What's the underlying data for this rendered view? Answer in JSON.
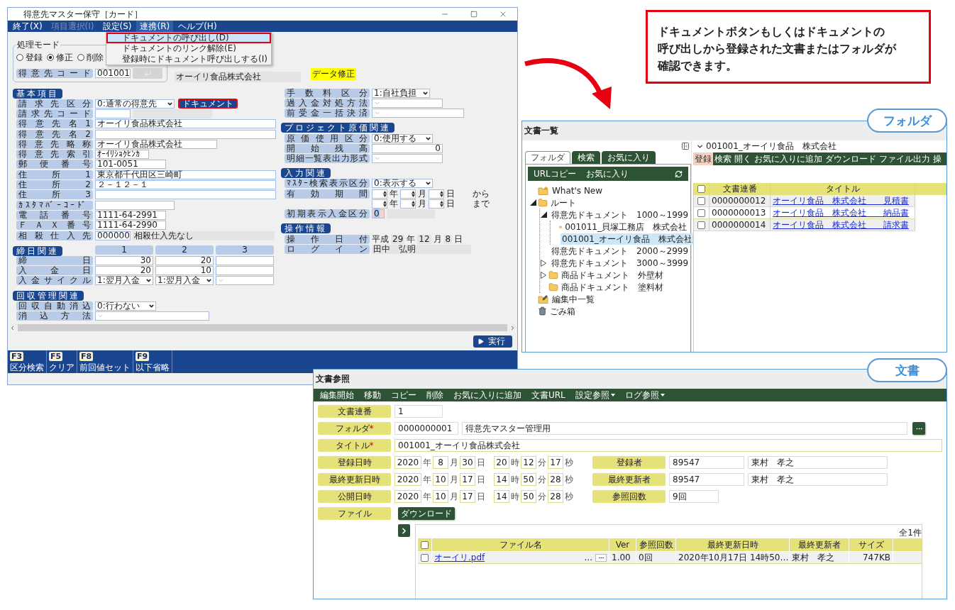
{
  "form_window": {
    "title": "得意先マスター保守［カード］",
    "menu": [
      {
        "label": "終了(X)",
        "disabled": false,
        "selected": false
      },
      {
        "label": "項目選択(I)",
        "disabled": true,
        "selected": false
      },
      {
        "label": "設定(S)",
        "disabled": false,
        "selected": false
      },
      {
        "label": "連携(R)",
        "disabled": false,
        "selected": true
      },
      {
        "label": "ヘルプ(H)",
        "disabled": false,
        "selected": false
      }
    ],
    "menu_dropdown": [
      {
        "label": "ドキュメントの呼び出し(D)",
        "selected": true,
        "annotated": true
      },
      {
        "label": "ドキュメントのリンク解除(E)",
        "selected": false,
        "annotated": false
      },
      {
        "label": "登録時にドキュメント呼び出しする(I)",
        "selected": false,
        "annotated": false
      }
    ],
    "mode": {
      "legend": "処理モード",
      "options": [
        {
          "label": "登録",
          "selected": false
        },
        {
          "label": "修正",
          "selected": true
        },
        {
          "label": "削除",
          "selected": false
        }
      ]
    },
    "code_row": {
      "label": "得意先コード",
      "value": "001001",
      "button_disabled": true,
      "name": "オーイリ食品株式会社"
    },
    "status_badge": "データ修正",
    "left_sections": [
      {
        "title": "基本項目",
        "rows": [
          {
            "label": "請求先区分",
            "fields": [
              {
                "kind": "select",
                "value": "0:通常の得意先"
              },
              {
                "kind": "button",
                "label": "ドキュメント",
                "annotated": true
              }
            ]
          },
          {
            "label": "請求先コード",
            "fields": [
              {
                "kind": "input"
              },
              {
                "kind": "readonly"
              }
            ]
          },
          {
            "label": "得意先名1",
            "fields": [
              {
                "kind": "input",
                "value": "オーイリ食品株式会社"
              }
            ]
          },
          {
            "label": "得意先名2",
            "fields": [
              {
                "kind": "input"
              }
            ]
          },
          {
            "label": "得意先略称",
            "fields": [
              {
                "kind": "input",
                "value": "オーイリ食品株式会社"
              }
            ]
          },
          {
            "label": "得意先索引",
            "fields": [
              {
                "kind": "input",
                "value": "ｵｰｲﾘｼｮｸﾋﾝｶ"
              }
            ]
          },
          {
            "label": "郵便番号",
            "fields": [
              {
                "kind": "input",
                "value": "101-0051"
              }
            ]
          },
          {
            "label": "住所1",
            "fields": [
              {
                "kind": "input",
                "value": "東京都千代田区三崎町"
              }
            ]
          },
          {
            "label": "住所2",
            "fields": [
              {
                "kind": "input",
                "value": "２－１２－１"
              }
            ]
          },
          {
            "label": "住所3",
            "fields": [
              {
                "kind": "input"
              }
            ]
          },
          {
            "label": "ｶｽﾀﾏﾊﾞｰｺｰﾄﾞ",
            "fields": [
              {
                "kind": "input"
              }
            ]
          },
          {
            "label": "電話番号",
            "fields": [
              {
                "kind": "input",
                "value": "1111-64-2991"
              }
            ]
          },
          {
            "label": "ＦＡＸ番号",
            "fields": [
              {
                "kind": "input",
                "value": "1111-64-2990"
              }
            ]
          },
          {
            "label": "相殺仕入先",
            "fields": [
              {
                "kind": "input",
                "value": "000000"
              },
              {
                "kind": "readonly",
                "value": "相殺仕入先なし"
              }
            ]
          }
        ]
      },
      {
        "title": "締日関連",
        "columns": [
          "1",
          "2",
          "3"
        ],
        "rows": [
          {
            "label": "締日",
            "fields": [
              {
                "kind": "number",
                "value": "30"
              },
              {
                "kind": "number",
                "value": "20"
              },
              {
                "kind": "number"
              }
            ]
          },
          {
            "label": "入金日",
            "fields": [
              {
                "kind": "number",
                "value": "20"
              },
              {
                "kind": "number",
                "value": "10"
              },
              {
                "kind": "number"
              }
            ]
          },
          {
            "label": "入金サイクル",
            "fields": [
              {
                "kind": "select",
                "value": "1:翌月入金"
              },
              {
                "kind": "select",
                "value": "1:翌月入金"
              },
              {
                "kind": "select"
              }
            ]
          }
        ]
      },
      {
        "title": "回収管理関連",
        "rows": [
          {
            "label": "回収自動消込",
            "fields": [
              {
                "kind": "select",
                "value": "0:行わない"
              }
            ]
          },
          {
            "label": "消込方法",
            "fields": [
              {
                "kind": "select"
              }
            ]
          }
        ]
      }
    ],
    "right_sections": [
      {
        "rows": [
          {
            "label": "手数料区分",
            "fields": [
              {
                "kind": "select",
                "value": "1:自社負担"
              }
            ]
          },
          {
            "label": "過入金対処方法",
            "fields": [
              {
                "kind": "select"
              }
            ]
          },
          {
            "label": "前受金一括決済",
            "fields": [
              {
                "kind": "select"
              }
            ]
          }
        ]
      },
      {
        "title": "プロジェクト原価関連",
        "rows": [
          {
            "label": "原価使用区分",
            "fields": [
              {
                "kind": "select",
                "value": "0:使用する"
              }
            ]
          },
          {
            "label": "開始残高",
            "fields": [
              {
                "kind": "number",
                "value": "0"
              }
            ]
          },
          {
            "label": "明細一覧表出力形式",
            "fields": [
              {
                "kind": "select"
              }
            ]
          }
        ]
      },
      {
        "title": "入力関連",
        "rows": [
          {
            "label": "ﾏｽﾀｰ検索表示区分",
            "fields": [
              {
                "kind": "select",
                "value": "0:表示する"
              }
            ]
          },
          {
            "label": "有効期間",
            "fields": [
              {
                "kind": "spin"
              },
              {
                "kind": "unit",
                "text": "年"
              },
              {
                "kind": "spin"
              },
              {
                "kind": "unit",
                "text": "月"
              },
              {
                "kind": "spin"
              },
              {
                "kind": "unit",
                "text": "日"
              },
              {
                "kind": "text",
                "text": "から"
              }
            ]
          },
          {
            "fields": [
              {
                "kind": "spin"
              },
              {
                "kind": "unit",
                "text": "年"
              },
              {
                "kind": "spin"
              },
              {
                "kind": "unit",
                "text": "月"
              },
              {
                "kind": "spin"
              },
              {
                "kind": "unit",
                "text": "日"
              },
              {
                "kind": "text",
                "text": "まで"
              }
            ]
          },
          {
            "label": "初期表示入金区分",
            "fields": [
              {
                "kind": "input",
                "value": "0",
                "focused": true
              },
              {
                "kind": "readonly"
              }
            ]
          }
        ]
      },
      {
        "title": "操作情報",
        "rows": [
          {
            "label": "操作日付",
            "fields": [
              {
                "kind": "unit",
                "text": "平成"
              },
              {
                "kind": "cell",
                "value": "29"
              },
              {
                "kind": "unit",
                "text": "年"
              },
              {
                "kind": "cell",
                "value": "12"
              },
              {
                "kind": "unit",
                "text": "月"
              },
              {
                "kind": "cell",
                "value": "8"
              },
              {
                "kind": "unit",
                "text": "日"
              }
            ]
          },
          {
            "label": "ログイン",
            "fields": [
              {
                "kind": "readonly",
                "value": "田中　弘明"
              }
            ]
          }
        ]
      }
    ],
    "execute_button": "実行",
    "function_keys": [
      {
        "key": "F3",
        "label": "区分検索"
      },
      {
        "key": "F5",
        "label": "クリア"
      },
      {
        "key": "F8",
        "label": "前回値セット"
      },
      {
        "key": "F9",
        "label": "以下省略"
      }
    ]
  },
  "callout": {
    "lines": [
      "ドキュメントボタンもしくはドキュメントの",
      "呼び出しから登録された文書またはフォルダが",
      "確認できます。"
    ]
  },
  "folder_window": {
    "title": "文書一覧",
    "badge": "フォルダ",
    "tabs": [
      {
        "label": "フォルダ",
        "selected": true
      },
      {
        "label": "検索",
        "selected": false
      },
      {
        "label": "お気に入り",
        "selected": false
      }
    ],
    "tree_toolbar": [
      "URLコピー",
      "お気に入り"
    ],
    "tree": [
      {
        "label": "What's New",
        "kind": "new",
        "selected": false
      },
      {
        "label": "ルート",
        "kind": "folder",
        "selected": false,
        "expanded": true,
        "children": [
          {
            "label": "得意先ドキュメント　1000～1999",
            "kind": "folder",
            "selected": false,
            "expanded": true,
            "children": [
              {
                "label": "001011_貝塚工務店　株式会社",
                "kind": "folder",
                "selected": false
              },
              {
                "label": "001001_オーイリ食品　株式会社",
                "kind": "folder",
                "selected": true
              }
            ]
          },
          {
            "label": "得意先ドキュメント　2000～2999",
            "kind": "folder",
            "selected": false
          },
          {
            "label": "得意先ドキュメント　3000～3999",
            "kind": "folder",
            "selected": false,
            "expanded": false
          },
          {
            "label": "商品ドキュメント　外壁材",
            "kind": "folder",
            "selected": false,
            "expanded": false
          },
          {
            "label": "商品ドキュメント　塗料材",
            "kind": "folder",
            "selected": false
          }
        ]
      },
      {
        "label": "編集中一覧",
        "kind": "edit",
        "selected": false
      },
      {
        "label": "ごみ箱",
        "kind": "trash",
        "selected": false
      }
    ],
    "path": "001001_オーイリ食品　株式会社",
    "actions": [
      {
        "label": "登録",
        "selected": true
      },
      {
        "label": "検索",
        "selected": false
      },
      {
        "label": "開く",
        "selected": false
      },
      {
        "label": "お気に入りに追加",
        "selected": false
      },
      {
        "label": "ダウンロード",
        "selected": false
      },
      {
        "label": "ファイル出力",
        "selected": false
      },
      {
        "label": "操",
        "selected": false
      }
    ],
    "all_checked": false,
    "columns": [
      "文書連番",
      "タイトル"
    ],
    "rows": [
      {
        "checked": false,
        "number": "0000000012",
        "title": "オーイリ食品　株式会社　　見積書"
      },
      {
        "checked": false,
        "number": "0000000013",
        "title": "オーイリ食品　株式会社　　納品書"
      },
      {
        "checked": false,
        "number": "0000000014",
        "title": "オーイリ食品　株式会社　　請求書"
      }
    ]
  },
  "document_window": {
    "title": "文書参照",
    "badge": "文書",
    "toolbar": [
      {
        "label": "編集開始",
        "dropdown": false
      },
      {
        "label": "移動",
        "dropdown": false
      },
      {
        "label": "コピー",
        "dropdown": false
      },
      {
        "label": "削除",
        "dropdown": false
      },
      {
        "label": "お気に入りに追加",
        "dropdown": false
      },
      {
        "label": "文書URL",
        "dropdown": false
      },
      {
        "label": "設定参照",
        "dropdown": true
      },
      {
        "label": "ログ参照",
        "dropdown": true
      }
    ],
    "serial": {
      "label": "文書連番",
      "value": "1"
    },
    "folder": {
      "label": "フォルダ",
      "required_mark": "*",
      "code": "0000000001",
      "name": "得意先マスター管理用"
    },
    "title_field": {
      "label": "タイトル",
      "required_mark": "*",
      "value": "001001_オーイリ食品株式会社"
    },
    "datetimes": [
      {
        "label": "登録日時",
        "parts": [
          {
            "value": "2020",
            "unit": "年"
          },
          {
            "value": "8",
            "unit": "月"
          },
          {
            "value": "30",
            "unit": "日"
          },
          {
            "value": "20",
            "unit": "時"
          },
          {
            "value": "12",
            "unit": "分"
          },
          {
            "value": "17",
            "unit": "秒"
          }
        ]
      },
      {
        "label": "最終更新日時",
        "parts": [
          {
            "value": "2020",
            "unit": "年"
          },
          {
            "value": "10",
            "unit": "月"
          },
          {
            "value": "17",
            "unit": "日"
          },
          {
            "value": "14",
            "unit": "時"
          },
          {
            "value": "50",
            "unit": "分"
          },
          {
            "value": "28",
            "unit": "秒"
          }
        ]
      },
      {
        "label": "公開日時",
        "parts": [
          {
            "value": "2020",
            "unit": "年"
          },
          {
            "value": "10",
            "unit": "月"
          },
          {
            "value": "17",
            "unit": "日"
          },
          {
            "value": "14",
            "unit": "時"
          },
          {
            "value": "50",
            "unit": "分"
          },
          {
            "value": "28",
            "unit": "秒"
          }
        ]
      }
    ],
    "people": [
      {
        "label": "登録者",
        "code": "89547",
        "name": "東村　孝之"
      },
      {
        "label": "最終更新者",
        "code": "89547",
        "name": "東村　孝之"
      },
      {
        "label": "参照回数",
        "code": "9回"
      }
    ],
    "file": {
      "label": "ファイル",
      "download": "ダウンロード",
      "count": "全1件",
      "all_checked": false,
      "columns": [
        "ファイル名",
        "Ver",
        "参照回数",
        "最終更新日時",
        "最終更新者",
        "サイズ"
      ],
      "rows": [
        {
          "checked": false,
          "name": "オーイリ.pdf",
          "ellipsis": "...",
          "ver": "1.00",
          "views": "0回",
          "updated": "2020年10月17日 14時50…",
          "updater": "東村　孝之",
          "size": "747KB"
        }
      ]
    }
  }
}
